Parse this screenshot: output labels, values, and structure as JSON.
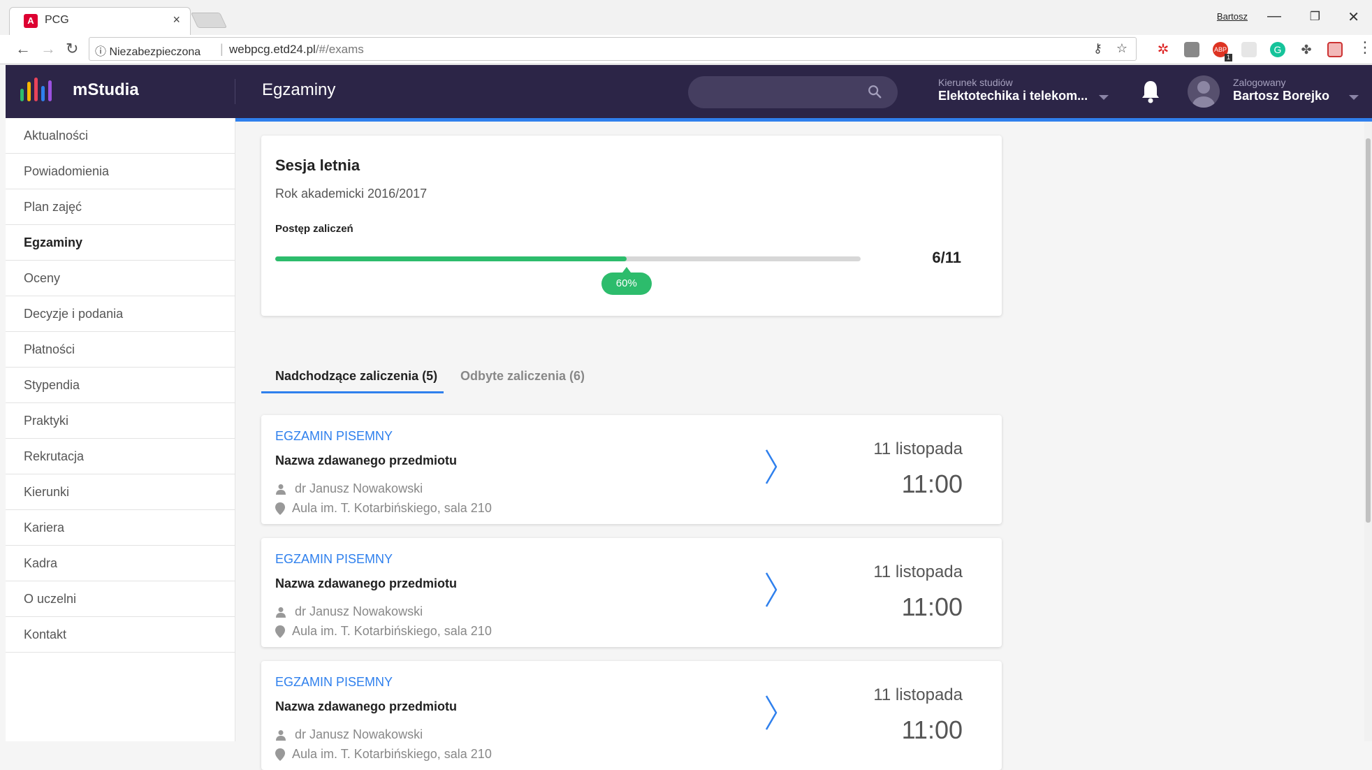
{
  "browser": {
    "tab_title": "PCG",
    "tab_close": "×",
    "profile_name": "Bartosz",
    "security_label": "ⓘ Niezabezpieczona",
    "url_host": "webpcg.etd24.pl",
    "url_path": "/#/exams",
    "window_controls": [
      "—",
      "❐",
      "✕"
    ],
    "extension_badge": "1"
  },
  "app": {
    "logo_text": "mStudia",
    "page_title": "Egzaminy",
    "search_placeholder": "",
    "program_caption": "Kierunek studiów",
    "program_value": "Elektotechika i telekom...",
    "user_caption": "Zalogowany",
    "user_name": "Bartosz Borejko",
    "accent_color": "#2f80ed",
    "header_color": "#2c2547",
    "success_color": "#2dbc6c"
  },
  "sidebar": {
    "items": [
      {
        "label": "Aktualności"
      },
      {
        "label": "Powiadomienia"
      },
      {
        "label": "Plan zajęć"
      },
      {
        "label": "Egzaminy",
        "active": true
      },
      {
        "label": "Oceny"
      },
      {
        "label": "Decyzje i podania"
      },
      {
        "label": "Płatności"
      },
      {
        "label": "Stypendia"
      },
      {
        "label": "Praktyki"
      },
      {
        "label": "Rekrutacja"
      },
      {
        "label": "Kierunki"
      },
      {
        "label": "Kariera"
      },
      {
        "label": "Kadra"
      },
      {
        "label": "O uczelni"
      },
      {
        "label": "Kontakt"
      }
    ]
  },
  "session": {
    "title": "Sesja letnia",
    "year": "Rok akademicki 2016/2017",
    "progress_label": "Postęp zaliczeń",
    "progress_fraction": 0.6,
    "progress_percent": "60%",
    "progress_count": "6/11"
  },
  "tabs": [
    {
      "label": "Nadchodzące zaliczenia (5)",
      "active": true
    },
    {
      "label": "Odbyte zaliczenia (6)",
      "active": false
    }
  ],
  "exams": [
    {
      "type": "EGZAMIN PISEMNY",
      "subject": "Nazwa zdawanego przedmiotu",
      "teacher": "dr Janusz Nowakowski",
      "place": "Aula im. T. Kotarbińskiego, sala 210",
      "date": "11 listopada",
      "time": "11:00"
    },
    {
      "type": "EGZAMIN PISEMNY",
      "subject": "Nazwa zdawanego przedmiotu",
      "teacher": "dr Janusz Nowakowski",
      "place": "Aula im. T. Kotarbińskiego, sala 210",
      "date": "11 listopada",
      "time": "11:00"
    },
    {
      "type": "EGZAMIN PISEMNY",
      "subject": "Nazwa zdawanego przedmiotu",
      "teacher": "dr Janusz Nowakowski",
      "place": "Aula im. T. Kotarbińskiego, sala 210",
      "date": "11 listopada",
      "time": "11:00"
    }
  ]
}
